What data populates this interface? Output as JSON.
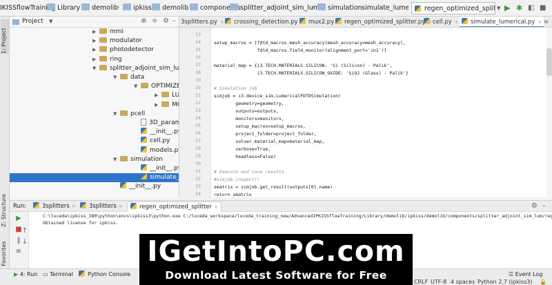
{
  "breadcrumb": [
    "IKISSflowTraining",
    "Library",
    "demolib",
    "ipkiss",
    "demolib",
    "components",
    "splitter_adjoint_sim_lum",
    "simulation",
    "simulate_lumerical.py"
  ],
  "run_config": "regen_optimized_splitter",
  "left_strip": {
    "project_tab": "1: Project",
    "structure_tab": "Z: Structure",
    "favorites_tab": "2: Favorites"
  },
  "project_panel": {
    "title": "Project"
  },
  "tree": [
    {
      "label": "mmi",
      "kind": "folder",
      "indent": 1,
      "arrow": "right"
    },
    {
      "label": "modulator",
      "kind": "folder",
      "indent": 1,
      "arrow": "right"
    },
    {
      "label": "photodetector",
      "kind": "folder",
      "indent": 1,
      "arrow": "right"
    },
    {
      "label": "ring",
      "kind": "folder",
      "indent": 1,
      "arrow": "right"
    },
    {
      "label": "splitter_adjoint_sim_lum",
      "kind": "folder",
      "indent": 1,
      "arrow": "down"
    },
    {
      "label": "data",
      "kind": "folder",
      "indent": 2,
      "arrow": "down"
    },
    {
      "label": "OPTIMIZED_SPLITTER",
      "kind": "folder",
      "indent": 3,
      "arrow": "down"
    },
    {
      "label": "LUM",
      "kind": "folder",
      "indent": 4,
      "arrow": "right"
    },
    {
      "label": "MODEL",
      "kind": "folder",
      "indent": 4,
      "arrow": "right"
    },
    {
      "label": "pcell",
      "kind": "folder",
      "indent": 2,
      "arrow": "down"
    },
    {
      "label": "3D_parameters.txt",
      "kind": "file",
      "indent": 3,
      "arrow": ""
    },
    {
      "label": "__init__.py",
      "kind": "py",
      "indent": 3,
      "arrow": ""
    },
    {
      "label": "cell.py",
      "kind": "py",
      "indent": 3,
      "arrow": ""
    },
    {
      "label": "models.py",
      "kind": "py",
      "indent": 3,
      "arrow": ""
    },
    {
      "label": "simulation",
      "kind": "folder",
      "indent": 2,
      "arrow": "down"
    },
    {
      "label": "__init__.py",
      "kind": "py",
      "indent": 3,
      "arrow": ""
    },
    {
      "label": "simulate_lumerical.py",
      "kind": "py",
      "indent": 3,
      "arrow": "",
      "selected": true
    },
    {
      "label": "__init__.py",
      "kind": "py",
      "indent": 2,
      "arrow": ""
    }
  ],
  "editor_tabs": [
    "3splitters.py",
    "crossing_detection.py",
    "mux2.py",
    "regen_optimized_splitter.py",
    "cell.py",
    "simulate_lumerical.py"
  ],
  "line_numbers": [
    "13",
    "14",
    "15",
    "16",
    "17",
    "18",
    "19",
    "20",
    "21",
    "22",
    "23",
    "24",
    "25",
    "26",
    "27",
    "28",
    "29",
    "30",
    "31",
    "32",
    "33",
    "34"
  ],
  "code": [
    "",
    "setup_macros = [fdtd_macros.mesh_accuracy(mesh_accuracy=mesh_accuracy),",
    "                fdtd_macros.field_monitor(alignment_port='in1')]",
    "",
    "material_map = {i3.TECH.MATERIALS.SILICON: 'Si (Silicon) - Palik',",
    "                i3.TECH.MATERIALS.SILICON_OXIDE: 'SiO2 (Glass) - Palik'}",
    "",
    "# Simulation job",
    "simjob = i3.device_sim.LumericalFDTDSimulation(",
    "        geometry=geometry,",
    "        outputs=outputs,",
    "        monitors=monitors,",
    "        setup_macros=setup_macros,",
    "        project_folder=project_folder,",
    "        solver_material_map=material_map,",
    "        verbose=True,",
    "        headless=False)",
    "",
    "# Execute and save_results.",
    "#simjob.inspect()",
    "smatrix = simjob.get_result(outputs[0].name)",
    "return smatrix"
  ],
  "run_panel": {
    "label": "Run:",
    "tabs": [
      "3splitters",
      "3splitters",
      "regen_optimized_splitter"
    ],
    "output": [
      "C:\\luceda\\ipkiss_380\\python\\envs\\ipkiss3\\python.exe C:/luceda_workspace/luceda_training_new/AdvancedIPKISSflowTraining/Library/demolib/ipkiss/demolib/components/splitter_adjoint_sim_lum/regen_optim",
      "Obtained license for ipkiss."
    ]
  },
  "bottom_tabs": {
    "run": "4: Run",
    "terminal": "Terminal",
    "console": "Python Console",
    "event_log": "Event Log"
  },
  "status": {
    "crlf": "CRLF",
    "encoding": "UTF-8",
    "indent": "4 spaces",
    "interpreter": "Python 2.7 (ipkiss3)"
  },
  "banner": {
    "title": "IGetIntoPC.com",
    "subtitle": "Download Latest Software for Free"
  }
}
